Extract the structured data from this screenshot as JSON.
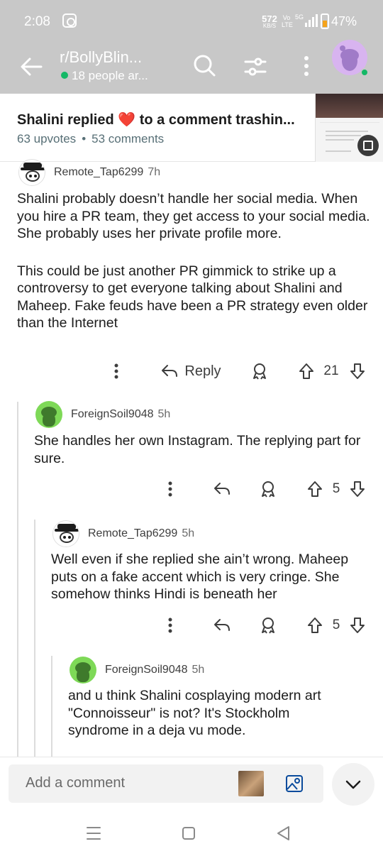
{
  "status_bar": {
    "time": "2:08",
    "net_speed": "572",
    "net_unit": "KB/S",
    "volte_top": "Vo",
    "volte_bottom": "LTE",
    "signal": "5G",
    "battery": "47%"
  },
  "app_bar": {
    "subreddit": "r/BollyBlin...",
    "online": "18 people ar...",
    "icons": [
      "back-arrow-icon",
      "search-icon",
      "filter-icon",
      "more-icon",
      "avatar"
    ]
  },
  "post": {
    "title": "Shalini replied ❤️ to a comment trashin...",
    "upvotes": "63 upvotes",
    "separator": "•",
    "comments": "53 comments"
  },
  "comments": [
    {
      "user": "Remote_Tap6299",
      "time": "7h",
      "paragraphs": [
        "Shalini probably doesn’t handle her social media. When you hire a PR team, they get access to your social media. She probably uses her private profile more.",
        "This could be just another PR gimmick to strike up a controversy to get everyone talking about Shalini and Maheep. Fake feuds have been a PR strategy even older than the Internet"
      ],
      "reply_label": "Reply",
      "votes": "21"
    },
    {
      "user": "ForeignSoil9048",
      "time": "5h",
      "paragraphs": [
        "She handles her own Instagram. The replying part for sure."
      ],
      "votes": "5"
    },
    {
      "user": "Remote_Tap6299",
      "time": "5h",
      "paragraphs": [
        "Well even if she replied she ain’t wrong. Maheep puts on a fake accent which is very cringe. She somehow thinks Hindi is beneath her"
      ],
      "votes": "5"
    },
    {
      "user": "ForeignSoil9048",
      "time": "5h",
      "paragraphs": [
        "and u think Shalini cosplaying modern art \"Connoisseur\" is not? It's Stockholm syndrome in a deja vu mode."
      ]
    }
  ],
  "composer": {
    "placeholder": "Add a comment"
  },
  "colors": {
    "app_bar": "#c8c8c8",
    "online_dot": "#14b866",
    "text": "#1c1c1c",
    "meta": "#576f76"
  }
}
